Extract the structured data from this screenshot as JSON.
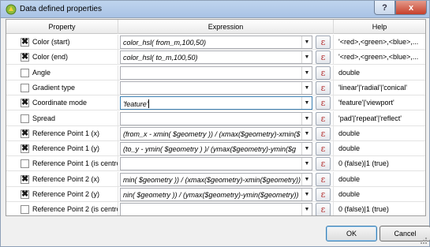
{
  "window": {
    "title": "Data defined properties",
    "help_button": "?",
    "close_button": "x"
  },
  "table": {
    "columns": [
      "Property",
      "Expression",
      "Help"
    ],
    "rows": [
      {
        "checked": true,
        "property": "Color (start)",
        "expression": "color_hsl( from_m,100,50)",
        "help": "'<red>,<green>,<blue>,..."
      },
      {
        "checked": true,
        "property": "Color (end)",
        "expression": "color_hsl( to_m,100,50)",
        "help": "'<red>,<green>,<blue>,..."
      },
      {
        "checked": false,
        "property": "Angle",
        "expression": "",
        "help": "double"
      },
      {
        "checked": false,
        "property": "Gradient type",
        "expression": "",
        "help": "'linear'|'radial'|'conical'"
      },
      {
        "checked": true,
        "property": "Coordinate mode",
        "expression": "'feature'",
        "help": "'feature'|'viewport'",
        "focused": true
      },
      {
        "checked": false,
        "property": "Spread",
        "expression": "",
        "help": "'pad'|'repeat'|'reflect'"
      },
      {
        "checked": true,
        "property": "Reference Point 1 (x)",
        "expression": "(from_x -  xmin(  $geometry )) / (xmax($geometry)-xmin($",
        "help": "double"
      },
      {
        "checked": true,
        "property": "Reference Point 1 (y)",
        "expression": "(to_y -  ymin(  $geometry ) )/ (ymax($geometry)-ymin($g",
        "help": "double"
      },
      {
        "checked": false,
        "property": "Reference Point 1 (is centro",
        "expression": "",
        "help": "0 (false)|1 (true)"
      },
      {
        "checked": true,
        "property": "Reference Point 2 (x)",
        "expression": "min(  $geometry )) / (xmax($geometry)-xmin($geometry))",
        "help": "double"
      },
      {
        "checked": true,
        "property": "Reference Point 2 (y)",
        "expression": "nin(  $geometry )) / (ymax($geometry)-ymin($geometry))",
        "help": "double"
      },
      {
        "checked": false,
        "property": "Reference Point 2 (is centro",
        "expression": "",
        "help": "0 (false)|1 (true)"
      }
    ]
  },
  "icons": {
    "epsilon_button": "ε",
    "dropdown_arrow": "▼",
    "checkmark": "✖"
  },
  "buttons": {
    "ok": "OK",
    "cancel": "Cancel"
  }
}
